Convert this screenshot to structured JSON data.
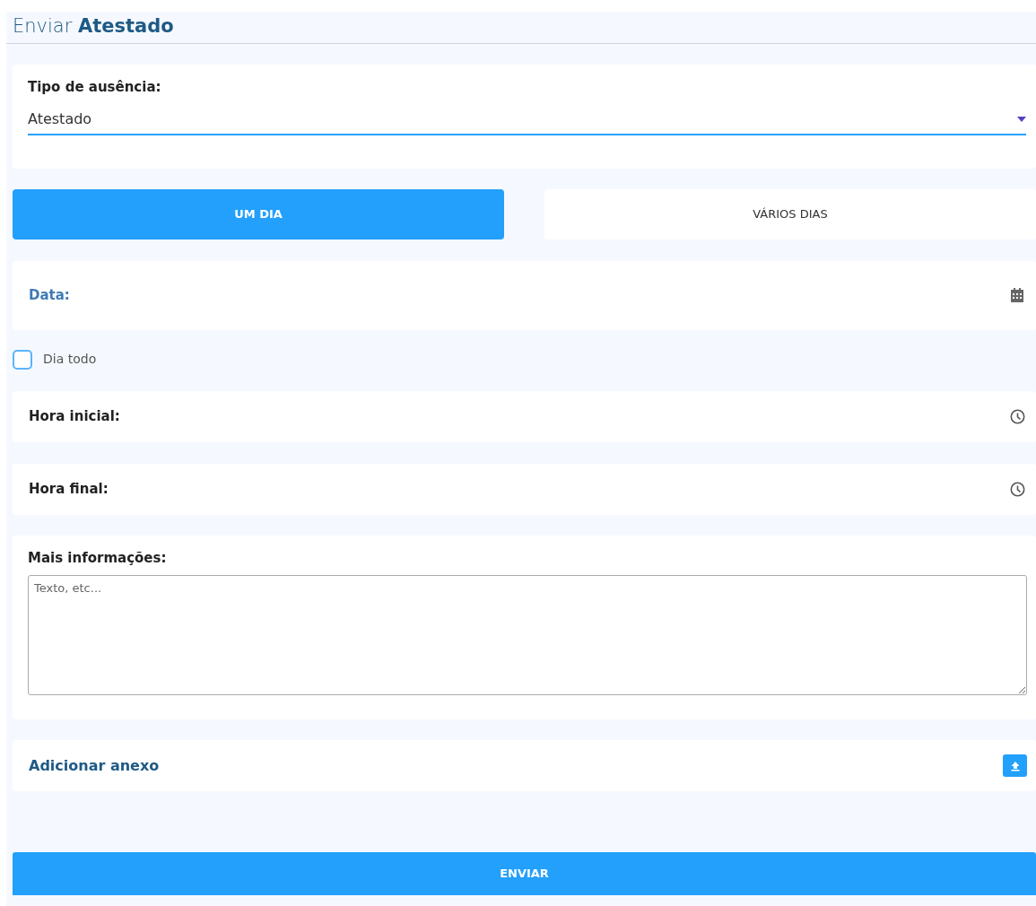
{
  "title": "Enviar **Atestado**",
  "absence_type": {
    "label": "Tipo de ausência:",
    "value": "Atestado"
  },
  "tabs": [
    {
      "label": "UM DIA",
      "selected": true
    },
    {
      "label": "VÁRIOS DIAS",
      "selected": false
    }
  ],
  "date": {
    "label": "Data:"
  },
  "all_day": {
    "label": "Dia todo",
    "checked": false
  },
  "time_fields": [
    {
      "label": "Hora inicial:"
    },
    {
      "label": "Hora final:"
    }
  ],
  "more_info": {
    "label": "Mais informações:",
    "placeholder": "Texto, etc..."
  },
  "attachment": {
    "label": "Adicionar anexo"
  },
  "submit": {
    "label": "ENVIAR"
  }
}
